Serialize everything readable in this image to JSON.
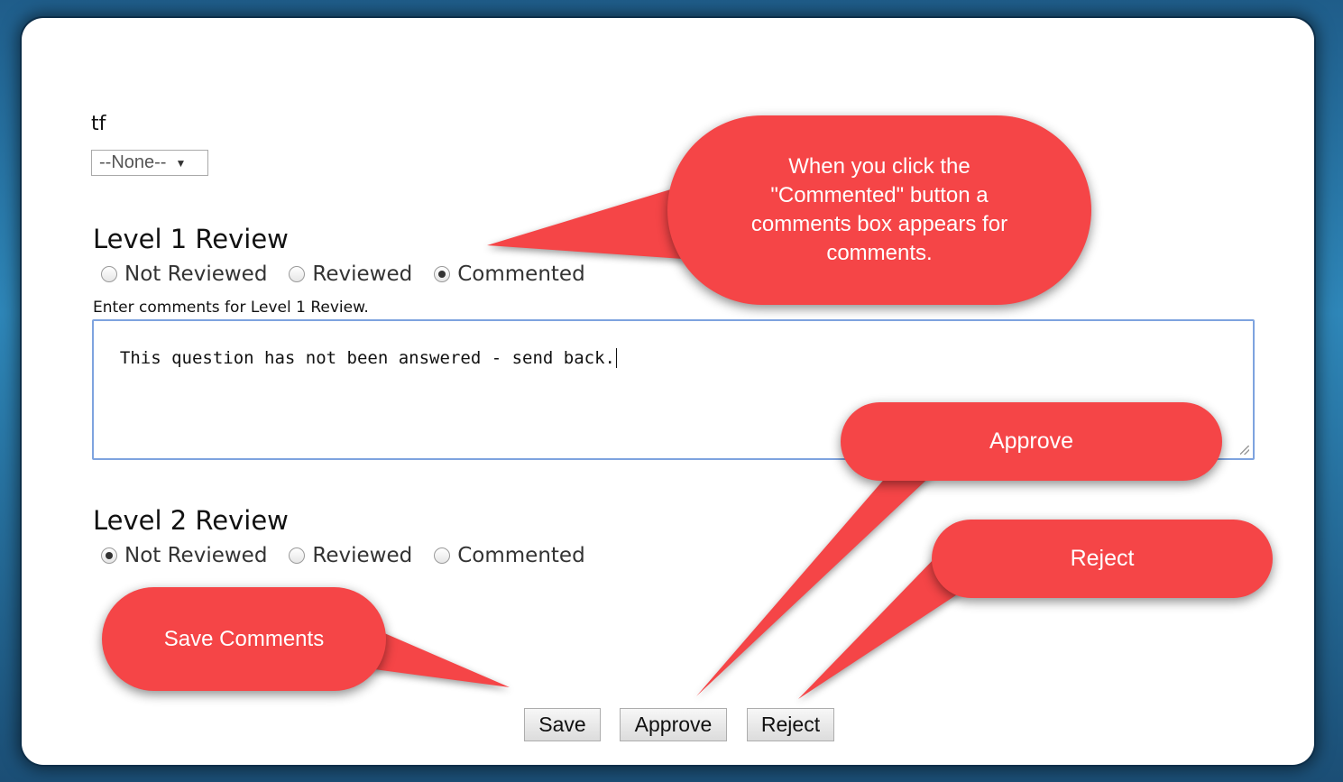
{
  "form": {
    "field_label": "tf",
    "select_value": "--None--",
    "level1": {
      "heading": "Level 1 Review",
      "options": [
        "Not Reviewed",
        "Reviewed",
        "Commented"
      ],
      "selected": "Commented",
      "comments_label": "Enter comments for Level 1 Review.",
      "comments_value": "This question has not been answered - send back."
    },
    "level2": {
      "heading": "Level 2 Review",
      "options": [
        "Not Reviewed",
        "Reviewed",
        "Commented"
      ],
      "selected": "Not Reviewed"
    }
  },
  "buttons": {
    "save": "Save",
    "approve": "Approve",
    "reject": "Reject"
  },
  "callouts": {
    "commented": "When you click the \"Commented\" button a comments box appears for comments.",
    "approve": "Approve",
    "reject": "Reject",
    "save": "Save Comments"
  },
  "colors": {
    "callout": "#f54547",
    "background": "#2e86b8"
  }
}
